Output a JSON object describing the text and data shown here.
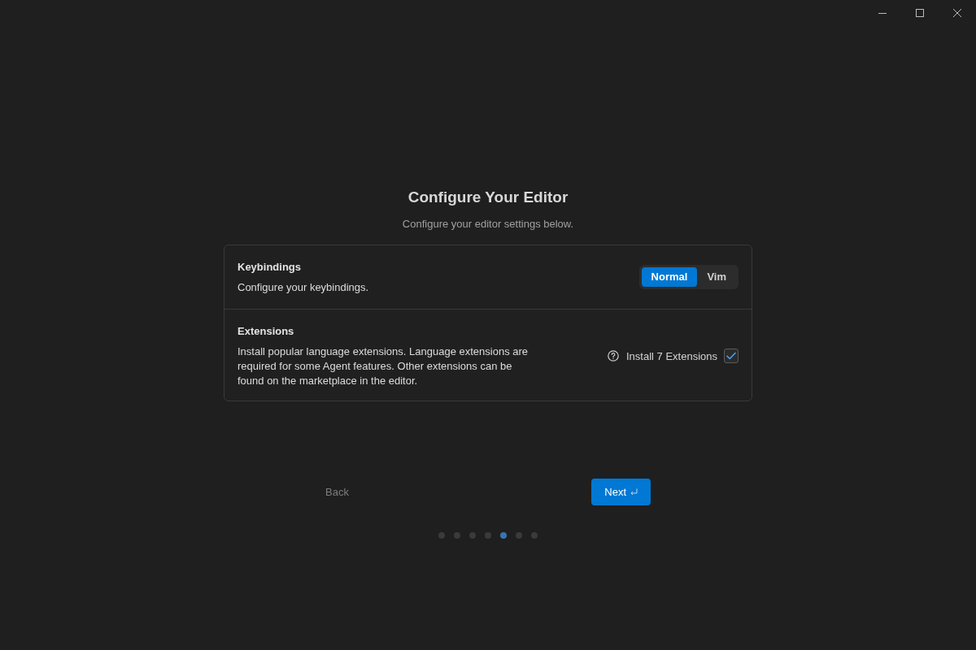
{
  "title": "Configure Your Editor",
  "subtitle": "Configure your editor settings below.",
  "settings": [
    {
      "kind": "segmented",
      "heading": "Keybindings",
      "description": "Configure your keybindings.",
      "options": [
        {
          "label": "Normal",
          "selected": true
        },
        {
          "label": "Vim",
          "selected": false
        }
      ]
    },
    {
      "kind": "checkbox",
      "heading": "Extensions",
      "description": "Install popular language extensions. Language extensions are required for some Agent features. Other extensions can be found on the marketplace in the editor.",
      "label": "Install 7 Extensions",
      "checked": true
    }
  ],
  "navigation": {
    "back": "Back",
    "next": "Next"
  },
  "steps": [
    {
      "selected": false
    },
    {
      "selected": false
    },
    {
      "selected": false
    },
    {
      "selected": false
    },
    {
      "selected": true
    },
    {
      "selected": false
    },
    {
      "selected": false
    }
  ]
}
